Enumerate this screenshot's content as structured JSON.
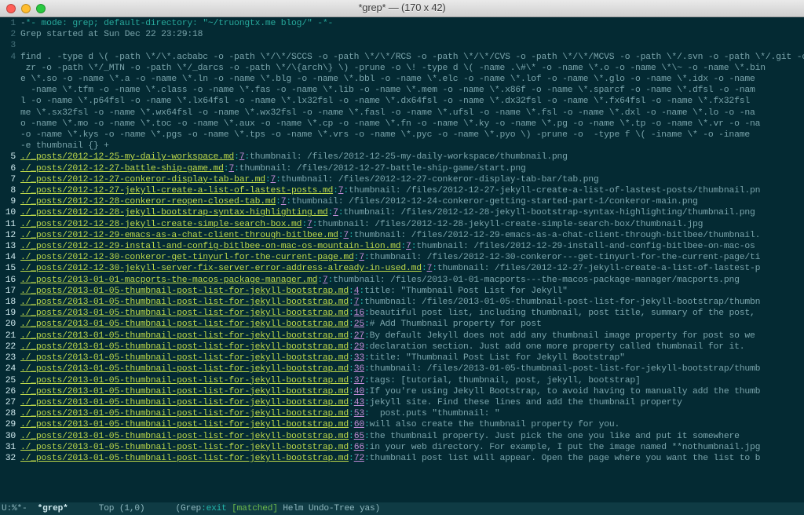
{
  "window": {
    "title": "*grep*  —  (170 x 42)"
  },
  "modeline": {
    "left": "U:%*-  ",
    "buffer": "*grep*",
    "position": "      Top (1,0)      (Grep",
    "mode": ":exit ",
    "match": "[matched]",
    "rest": " Helm Undo-Tree yas)"
  },
  "header_lines": [
    {
      "num": "1",
      "type": "string",
      "pre": "-",
      "text": "*- mode: grep; default-directory: \"~/truongtx.me blog/\" -*-"
    },
    {
      "num": "2",
      "type": "plain",
      "text": "Grep started at Sun Dec 22 23:29:18"
    },
    {
      "num": "3",
      "type": "plain",
      "text": ""
    },
    {
      "num": "4",
      "type": "plain",
      "text": "find . -type d \\( -path \\*/\\*.acbabc -o -path \\*/\\*/SCCS -o -path \\*/\\*/RCS -o -path \\*/\\*/CVS -o -path \\*/\\*/MCVS -o -path \\*/.svn -o -path \\*/.git -o -p"
    },
    {
      "num": "",
      "type": "plain",
      "text": " zr -o -path \\*/_MTN -o -path \\*/_darcs -o -path \\*/\\{arch\\} \\) -prune -o \\! -type d \\( -name .\\#\\* -o -name \\*.o -o -name \\*\\~ -o -name \\*.bin"
    },
    {
      "num": "",
      "type": "plain",
      "text": "e \\*.so -o -name \\*.a -o -name \\*.ln -o -name \\*.blg -o -name \\*.bbl -o -name \\*.elc -o -name \\*.lof -o -name \\*.glo -o -name \\*.idx -o -name"
    },
    {
      "num": "",
      "type": "plain",
      "text": "  -name \\*.tfm -o -name \\*.class -o -name \\*.fas -o -name \\*.lib -o -name \\*.mem -o -name \\*.x86f -o -name \\*.sparcf -o -name \\*.dfsl -o -nam"
    },
    {
      "num": "",
      "type": "plain",
      "text": "l -o -name \\*.p64fsl -o -name \\*.lx64fsl -o -name \\*.lx32fsl -o -name \\*.dx64fsl -o -name \\*.dx32fsl -o -name \\*.fx64fsl -o -name \\*.fx32fsl"
    },
    {
      "num": "",
      "type": "plain",
      "text": "me \\*.sx32fsl -o -name \\*.wx64fsl -o -name \\*.wx32fsl -o -name \\*.fasl -o -name \\*.ufsl -o -name \\*.fsl -o -name \\*.dxl -o -name \\*.lo -o -na"
    },
    {
      "num": "",
      "type": "plain",
      "text": "o -name \\*.mo -o -name \\*.toc -o -name \\*.aux -o -name \\*.cp -o -name \\*.fn -o -name \\*.ky -o -name \\*.pg -o -name \\*.tp -o -name \\*.vr -o -na"
    },
    {
      "num": "",
      "type": "plain",
      "text": "-o -name \\*.kys -o -name \\*.pgs -o -name \\*.tps -o -name \\*.vrs -o -name \\*.pyc -o -name \\*.pyo \\) -prune -o  -type f \\( -iname \\* -o -iname"
    },
    {
      "num": "",
      "type": "plain",
      "text": "-e thumbnail {} +"
    }
  ],
  "hits": [
    {
      "num": "5",
      "file": "./_posts/2012-12-25-my-daily-workspace.md",
      "ln": "7",
      "text": "thumbnail: /files/2012-12-25-my-daily-workspace/thumbnail.png"
    },
    {
      "num": "6",
      "file": "./_posts/2012-12-27-battle-ship-game.md",
      "ln": "7",
      "text": "thumbnail: /files/2012-12-27-battle-ship-game/start.png"
    },
    {
      "num": "7",
      "file": "./_posts/2012-12-27-conkeror-display-tab-bar.md",
      "ln": "7",
      "text": "thumbnail: /files/2012-12-27-conkeror-display-tab-bar/tab.png"
    },
    {
      "num": "8",
      "file": "./_posts/2012-12-27-jekyll-create-a-list-of-lastest-posts.md",
      "ln": "7",
      "text": "thumbnail: /files/2012-12-27-jekyll-create-a-list-of-lastest-posts/thumbnail.pn"
    },
    {
      "num": "9",
      "file": "./_posts/2012-12-28-conkeror-reopen-closed-tab.md",
      "ln": "7",
      "text": "thumbnail: /files/2012-12-24-conkeror-getting-started-part-1/conkeror-main.png"
    },
    {
      "num": "10",
      "file": "./_posts/2012-12-28-jekyll-bootstrap-syntax-highlighting.md",
      "ln": "7",
      "text": "thumbnail: /files/2012-12-28-jekyll-bootstrap-syntax-highlighting/thumbnail.png"
    },
    {
      "num": "11",
      "file": "./_posts/2012-12-28-jekyll-create-simple-search-box.md",
      "ln": "7",
      "text": "thumbnail: /files/2012-12-28-jekyll-create-simple-search-box/thumbnail.jpg"
    },
    {
      "num": "12",
      "file": "./_posts/2012-12-29-emacs-as-a-chat-client-through-bitlbee.md",
      "ln": "7",
      "text": "thumbnail: /files/2012-12-29-emacs-as-a-chat-client-through-bitlbee/thumbnail."
    },
    {
      "num": "13",
      "file": "./_posts/2012-12-29-install-and-config-bitlbee-on-mac-os-mountain-lion.md",
      "ln": "7",
      "text": "thumbnail: /files/2012-12-29-install-and-config-bitlbee-on-mac-os"
    },
    {
      "num": "14",
      "file": "./_posts/2012-12-30-conkeror-get-tinyurl-for-the-current-page.md",
      "ln": "7",
      "text": "thumbnail: /files/2012-12-30-conkeror---get-tinyurl-for-the-current-page/ti"
    },
    {
      "num": "15",
      "file": "./_posts/2012-12-30-jekyll-server-fix-server-error-address-already-in-used.md",
      "ln": "7",
      "text": "thumbnail: /files/2012-12-27-jekyll-create-a-list-of-lastest-p"
    },
    {
      "num": "16",
      "file": "./_posts/2013-01-01-macports-the-macos-package-manager.md",
      "ln": "7",
      "text": "thumbnail: /files/2013-01-01-macports---the-macos-package-manager/macports.png"
    },
    {
      "num": "17",
      "file": "./_posts/2013-01-05-thumbnail-post-list-for-jekyll-bootstrap.md",
      "ln": "4",
      "text": "title: \"Thumbnail Post List for Jekyll\""
    },
    {
      "num": "18",
      "file": "./_posts/2013-01-05-thumbnail-post-list-for-jekyll-bootstrap.md",
      "ln": "7",
      "text": "thumbnail: /files/2013-01-05-thumbnail-post-list-for-jekyll-bootstrap/thumbn"
    },
    {
      "num": "19",
      "file": "./_posts/2013-01-05-thumbnail-post-list-for-jekyll-bootstrap.md",
      "ln": "16",
      "text": "beautiful post list, including thumbnail, post title, summary of the post,"
    },
    {
      "num": "20",
      "file": "./_posts/2013-01-05-thumbnail-post-list-for-jekyll-bootstrap.md",
      "ln": "25",
      "text": "# Add Thumbnail property for post"
    },
    {
      "num": "21",
      "file": "./_posts/2013-01-05-thumbnail-post-list-for-jekyll-bootstrap.md",
      "ln": "27",
      "text": "By default Jekyll does not add any thumbnail image property for post so we"
    },
    {
      "num": "22",
      "file": "./_posts/2013-01-05-thumbnail-post-list-for-jekyll-bootstrap.md",
      "ln": "29",
      "text": "declaration section. Just add one more property called thumbnail for it."
    },
    {
      "num": "23",
      "file": "./_posts/2013-01-05-thumbnail-post-list-for-jekyll-bootstrap.md",
      "ln": "33",
      "text": "title: \"Thumbnail Post List for Jekyll Bootstrap\""
    },
    {
      "num": "24",
      "file": "./_posts/2013-01-05-thumbnail-post-list-for-jekyll-bootstrap.md",
      "ln": "36",
      "text": "thumbnail: /files/2013-01-05-thumbnail-post-list-for-jekyll-bootstrap/thumb"
    },
    {
      "num": "25",
      "file": "./_posts/2013-01-05-thumbnail-post-list-for-jekyll-bootstrap.md",
      "ln": "37",
      "text": "tags: [tutorial, thumbnail, post, jekyll, bootstrap]"
    },
    {
      "num": "26",
      "file": "./_posts/2013-01-05-thumbnail-post-list-for-jekyll-bootstrap.md",
      "ln": "40",
      "text": "If you're using Jekyll Bootstrap, to avoid having to manually add the thumb"
    },
    {
      "num": "27",
      "file": "./_posts/2013-01-05-thumbnail-post-list-for-jekyll-bootstrap.md",
      "ln": "43",
      "text": "jekyll site. Find these lines and add the thumbnail property"
    },
    {
      "num": "28",
      "file": "./_posts/2013-01-05-thumbnail-post-list-for-jekyll-bootstrap.md",
      "ln": "53",
      "text": "  post.puts \"thumbnail: \""
    },
    {
      "num": "29",
      "file": "./_posts/2013-01-05-thumbnail-post-list-for-jekyll-bootstrap.md",
      "ln": "60",
      "text": "will also create the thumbnail property for you."
    },
    {
      "num": "30",
      "file": "./_posts/2013-01-05-thumbnail-post-list-for-jekyll-bootstrap.md",
      "ln": "65",
      "text": "the thumbnail property. Just pick the one you like and put it somewhere"
    },
    {
      "num": "31",
      "file": "./_posts/2013-01-05-thumbnail-post-list-for-jekyll-bootstrap.md",
      "ln": "66",
      "text": "in your web directory. For example, I put the image named **nothumbnail.jpg"
    },
    {
      "num": "32",
      "file": "./_posts/2013-01-05-thumbnail-post-list-for-jekyll-bootstrap.md",
      "ln": "72",
      "text": "thumbnail post list will appear. Open the page where you want the list to b"
    }
  ]
}
